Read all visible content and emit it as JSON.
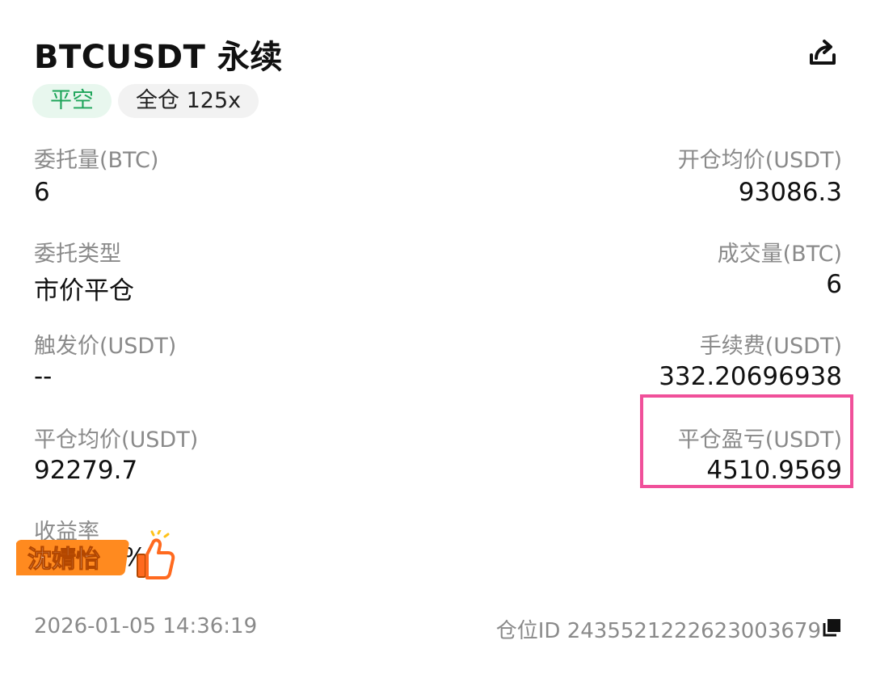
{
  "header": {
    "title": "BTCUSDT 永续",
    "share_icon": "share-icon"
  },
  "badges": {
    "side": "平空",
    "margin": "全仓 125x"
  },
  "fields": {
    "order_qty": {
      "label": "委托量(BTC)",
      "value": "6"
    },
    "open_avg_price": {
      "label": "开仓均价(USDT)",
      "value": "93086.3"
    },
    "order_type": {
      "label": "委托类型",
      "value": "市价平仓"
    },
    "filled_qty": {
      "label": "成交量(BTC)",
      "value": "6"
    },
    "trigger_price": {
      "label": "触发价(USDT)",
      "value": "--"
    },
    "fee": {
      "label": "手续费(USDT)",
      "value": "332.20696938"
    },
    "close_avg_price": {
      "label": "平仓均价(USDT)",
      "value": "92279.7"
    },
    "close_pnl": {
      "label": "平仓盈亏(USDT)",
      "value": "4510.9569"
    },
    "roi": {
      "label": "收益率",
      "value": "%"
    }
  },
  "footer": {
    "datetime": "2026-01-05 14:36:19",
    "position_id": "仓位ID 2435521222623003679",
    "copy_icon": "copy-icon"
  },
  "sticker": {
    "text": "沈婧怡",
    "icon": "thumbs-up-icon"
  },
  "colors": {
    "accent_green": "#1ea55a",
    "highlight_pink": "#f0509a",
    "label_gray": "#8a8a8a"
  }
}
